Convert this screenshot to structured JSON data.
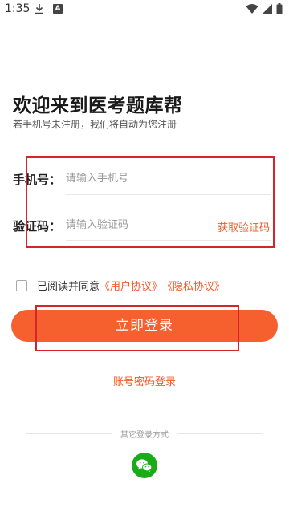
{
  "status_bar": {
    "time": "1:35",
    "icons": [
      "download-icon",
      "a-badge-icon",
      "wifi-icon",
      "signal-icon",
      "battery-icon"
    ]
  },
  "welcome": {
    "title": "欢迎来到医考题库帮",
    "subtitle": "若手机号未注册，我们将自动为您注册"
  },
  "form": {
    "phone_label": "手机号：",
    "phone_placeholder": "请输入手机号",
    "phone_value": "",
    "code_label": "验证码：",
    "code_placeholder": "请输入验证码",
    "code_value": "",
    "get_code_label": "获取验证码"
  },
  "agreement": {
    "checked": false,
    "prefix": "已阅读并同意",
    "user_agreement": "《用户协议》",
    "privacy_agreement": "《隐私协议》"
  },
  "login_button_label": "立即登录",
  "account_login_label": "账号密码登录",
  "other_login": {
    "label": "其它登录方式",
    "methods": [
      "wechat-icon"
    ]
  },
  "colors": {
    "accent": "#f5602e",
    "link": "#f25a2a",
    "annotation_box": "#d4252b",
    "wechat": "#1aab19"
  }
}
